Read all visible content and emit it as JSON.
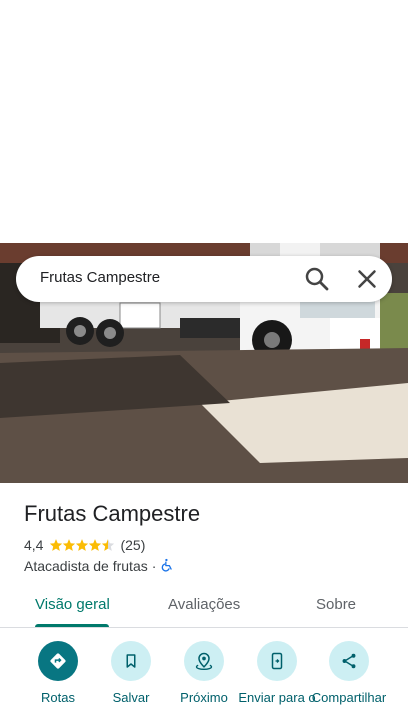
{
  "search": {
    "query": "Frutas Campestre"
  },
  "place": {
    "name": "Frutas Campestre",
    "rating": "4,4",
    "rating_value": 4.4,
    "review_count": "(25)",
    "category": "Atacadista de frutas",
    "separator": "·"
  },
  "tabs": [
    {
      "label": "Visão geral",
      "active": true
    },
    {
      "label": "Avaliações",
      "active": false
    },
    {
      "label": "Sobre",
      "active": false
    }
  ],
  "actions": [
    {
      "label": "Rotas",
      "icon": "directions-icon"
    },
    {
      "label": "Salvar",
      "icon": "bookmark-icon"
    },
    {
      "label": "Próximo",
      "icon": "nearby-icon"
    },
    {
      "label": "Enviar para o",
      "icon": "send-to-phone-icon"
    },
    {
      "label": "Compartilhar",
      "icon": "share-icon"
    }
  ],
  "colors": {
    "accent": "#00796b",
    "star": "#fbbc04",
    "action_primary_bg": "#087682",
    "action_bg": "#cdeff3",
    "accessibility": "#1a73e8"
  }
}
